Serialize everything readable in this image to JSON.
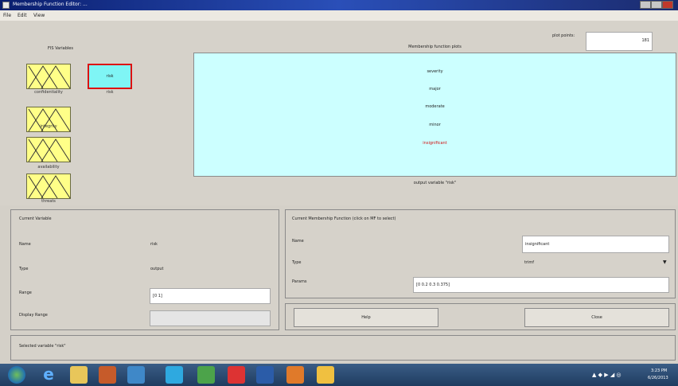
{
  "window": {
    "title": "Membership Function Editor: ..."
  },
  "menu": [
    "File",
    "Edit",
    "View"
  ],
  "fis_panel": {
    "title": "FIS Variables",
    "inputs": [
      "confidentiality",
      "integrity",
      "availability",
      "threats"
    ],
    "output_label": "risk",
    "output_box_text": "risk"
  },
  "plot": {
    "plot_points_label": "plot points:",
    "plot_points_value": "181",
    "title": "Membership function plots",
    "mfs": [
      "severity",
      "major",
      "moderate",
      "minor",
      "insignificant"
    ],
    "selected_mf": "insignificant",
    "variable_caption": "output variable \"risk\""
  },
  "current_variable": {
    "title": "Current Variable",
    "name_label": "Name",
    "name_value": "risk",
    "type_label": "Type",
    "type_value": "output",
    "range_label": "Range",
    "range_value": "[0 1]",
    "display_range_label": "Display Range",
    "display_range_value": ""
  },
  "current_mf": {
    "title": "Current Membership Function (click on MF to select)",
    "name_label": "Name",
    "name_value": "insignificant",
    "type_label": "Type",
    "type_value": "trimf",
    "params_label": "Params",
    "params_value": "[0 0.2 0.3 0.375]"
  },
  "buttons": {
    "help": "Help",
    "close": "Close"
  },
  "status": "Selected variable \"risk\"",
  "taskbar": {
    "time": "3:23 PM",
    "date": "6/26/2013"
  },
  "colors": {
    "input_box": "#ffff88",
    "output_box": "#7ff5f5",
    "plot_bg": "#ccffff",
    "selected": "#d11111"
  }
}
